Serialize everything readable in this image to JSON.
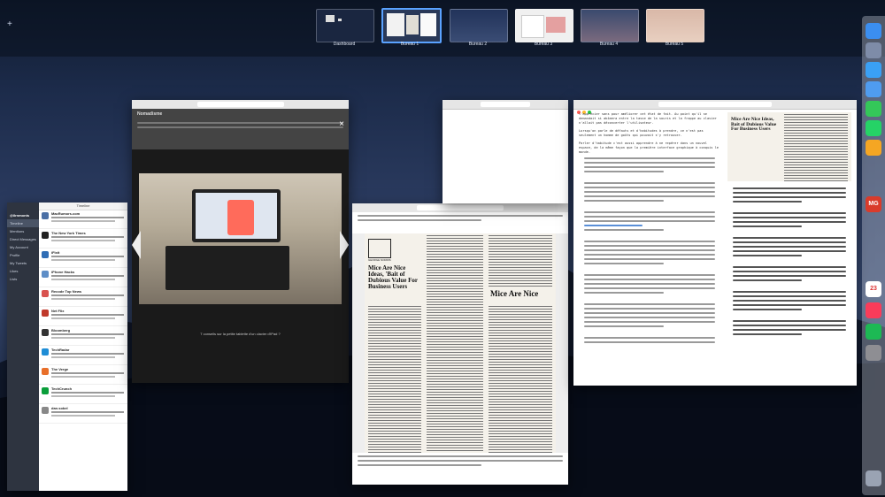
{
  "mission_control": {
    "spaces": [
      {
        "label": "Dashboard",
        "active": false
      },
      {
        "label": "Bureau 1",
        "active": true
      },
      {
        "label": "Bureau 2",
        "active": false
      },
      {
        "label": "Bureau 3",
        "active": false
      },
      {
        "label": "Bureau 4",
        "active": false
      },
      {
        "label": "Bureau 5",
        "active": false
      }
    ],
    "add_label": "+"
  },
  "twitter": {
    "title": "Timeline",
    "user": "@ilrnmonts",
    "sidebar": [
      "Timeline",
      "Mentions",
      "Direct Messages",
      "My Account",
      "Profile",
      "My Tweets",
      "Likes",
      "Lists"
    ],
    "items": [
      {
        "name": "MacRumors.com"
      },
      {
        "name": "The New York Times"
      },
      {
        "name": "iFixit"
      },
      {
        "name": "iPhone Hacks"
      },
      {
        "name": "Recode Top News"
      },
      {
        "name": "Net Flix"
      },
      {
        "name": "Bloomberg"
      },
      {
        "name": "TechRadar"
      },
      {
        "name": "The Verge"
      },
      {
        "name": "TechCrunch"
      },
      {
        "name": "dan.sobel"
      }
    ]
  },
  "photo_viewer": {
    "caption": "7 conseils sur la petite tablette d'un clavier d'iPad ?",
    "close": "×",
    "heading": "Nomadisme"
  },
  "newspaper": {
    "headline_left": "Mice Are Nice Ideas, 'Bait of Dubious Value For Business Users",
    "headline_right": "Mice Are Nice",
    "byline": "GEORGE NORRIS"
  },
  "article_doc": {
    "heading_left": "Mice Are Nice Ideas, Bait of Dubious Value For Business Users",
    "paragraphs": [
      "l'apprécier sans pour améliorer cet état de fait. Au point qu'il se demandait si abîmera entre la tasse de la souris et la frappe au clavier n'allait pas déconcerter l'utilisateur.",
      "Lorsqu'on parle de défauts et d'habitudes à prendre, ce n'est pas seulement un homme de goûts qui pouvait s'y retrouver.",
      "Parler d'habitude c'est aussi apprendre à ne repérer dans un nouvel espace, de la même façon que la première interface graphique à conquis le monde."
    ]
  },
  "dock": {
    "icons": [
      "finder-icon",
      "launchpad-icon",
      "safari-icon",
      "mail-icon",
      "messages-icon",
      "whatsapp-icon",
      "photos-icon",
      "notes-icon",
      "calendar-icon",
      "music-icon",
      "spotify-icon",
      "settings-icon",
      "trash-icon"
    ],
    "labels": [
      "",
      "",
      "",
      "",
      "",
      "",
      "",
      "MG",
      "23",
      "",
      "",
      "",
      ""
    ],
    "colors": [
      "#3b8ef0",
      "#7e8ca8",
      "#3aa0f5",
      "#4f9cf0",
      "#34c759",
      "#25d366",
      "#f5a623",
      "#d93b2b",
      "#ffffff",
      "#fa3c5a",
      "#1db954",
      "#8e8e93",
      "#9aa3b3"
    ]
  }
}
